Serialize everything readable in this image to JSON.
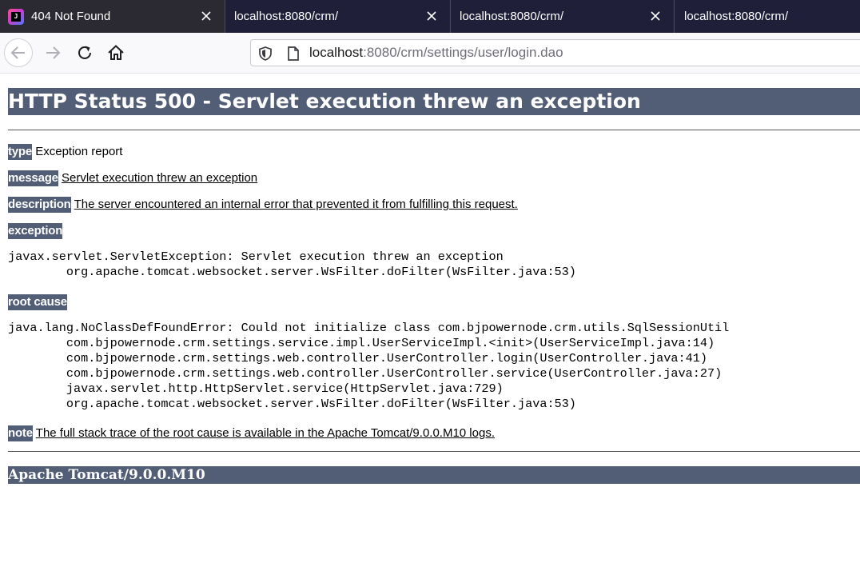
{
  "browser": {
    "tabs": [
      {
        "title": "404 Not Found",
        "favicon": "jetbrains-logo-icon",
        "active": true
      },
      {
        "title": "localhost:8080/crm/",
        "active": false
      },
      {
        "title": "localhost:8080/crm/",
        "active": false
      },
      {
        "title": "localhost:8080/crm/",
        "active": false
      }
    ],
    "url_host": "localhost",
    "url_rest": ":8080/crm/settings/user/login.dao",
    "icons": {
      "back": "back-arrow-icon",
      "forward": "forward-arrow-icon",
      "reload": "reload-icon",
      "home": "home-icon",
      "shield": "shield-icon",
      "page": "page-icon",
      "close": "close-icon"
    }
  },
  "page": {
    "title": "HTTP Status 500 - Servlet execution threw an exception",
    "type_label": "type",
    "type_value": "Exception report",
    "message_label": "message",
    "message_value": "Servlet execution threw an exception",
    "description_label": "description",
    "description_value": "The server encountered an internal error that prevented it from fulfilling this request.",
    "exception_label": "exception",
    "exception_trace": "javax.servlet.ServletException: Servlet execution threw an exception\n\torg.apache.tomcat.websocket.server.WsFilter.doFilter(WsFilter.java:53)",
    "root_cause_label": "root cause",
    "root_cause_trace": "java.lang.NoClassDefFoundError: Could not initialize class com.bjpowernode.crm.utils.SqlSessionUtil\n\tcom.bjpowernode.crm.settings.service.impl.UserServiceImpl.<init>(UserServiceImpl.java:14)\n\tcom.bjpowernode.crm.settings.web.controller.UserController.login(UserController.java:41)\n\tcom.bjpowernode.crm.settings.web.controller.UserController.service(UserController.java:27)\n\tjavax.servlet.http.HttpServlet.service(HttpServlet.java:729)\n\torg.apache.tomcat.websocket.server.WsFilter.doFilter(WsFilter.java:53)",
    "note_label": "note",
    "note_value": "The full stack trace of the root cause is available in the Apache Tomcat/9.0.0.M10 logs.",
    "footer": "Apache Tomcat/9.0.0.M10"
  },
  "colors": {
    "tomcat_header": "#525d76",
    "tabstrip": "#1f1f3a",
    "active_tab": "#2b2a33"
  }
}
